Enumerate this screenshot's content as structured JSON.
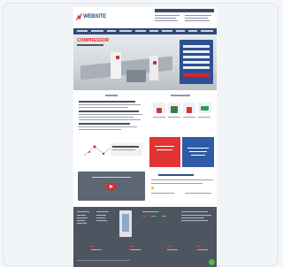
{
  "site": {
    "logo_text": "WEBSITE",
    "hero_title": "COMPRESSOR",
    "colors": {
      "brand_blue": "#2f4f8f",
      "nav_blue": "#324a7a",
      "accent_red": "#d8262e",
      "footer_gray": "#4d5561",
      "chat_green": "#58b845"
    },
    "icons": [
      "logo-mark-icon",
      "play-icon",
      "chat-icon"
    ]
  }
}
